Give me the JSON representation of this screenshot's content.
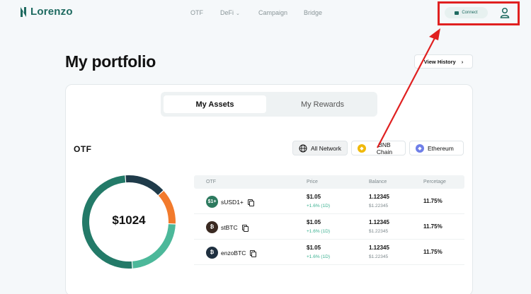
{
  "brand": {
    "name": "Lorenzo"
  },
  "nav": [
    {
      "label": "OTF"
    },
    {
      "label": "DeFi"
    },
    {
      "label": "Campaign"
    },
    {
      "label": "Bridge"
    }
  ],
  "header": {
    "connect_label": "Connect"
  },
  "page": {
    "title": "My portfolio",
    "view_history_label": "View History"
  },
  "tabs": [
    {
      "label": "My Assets",
      "active": true
    },
    {
      "label": "My Rewards",
      "active": false
    }
  ],
  "section": {
    "label": "OTF"
  },
  "networks": [
    {
      "label": "All Network",
      "icon": "globe-icon",
      "selected": true
    },
    {
      "label": "BNB Chain",
      "icon": "bnb-icon",
      "color": "#f0b90b"
    },
    {
      "label": "Ethereum",
      "icon": "ethereum-icon",
      "color": "#6f7fe8"
    }
  ],
  "total": {
    "value": "$1024"
  },
  "donut_segments": [
    {
      "color": "#1f3b4a",
      "fraction": 0.145
    },
    {
      "color": "#f27a2c",
      "fraction": 0.125
    },
    {
      "color": "#4cb89a",
      "fraction": 0.23
    },
    {
      "color": "#237a68",
      "fraction": 0.5
    }
  ],
  "table": {
    "headers": [
      "OTF",
      "Price",
      "Balance",
      "Percetage"
    ],
    "rows": [
      {
        "name": "sUSD1+",
        "coin_color": "#2d7a5f",
        "coin_text": "$1+",
        "price": "$1.05",
        "change": "+1.6% (1D)",
        "balance": "1.12345",
        "balance_usd": "$1.22345",
        "percent": "11.75%"
      },
      {
        "name": "stBTC",
        "coin_color": "#3a2a22",
        "coin_text": "₿",
        "price": "$1.05",
        "change": "+1.6% (1D)",
        "balance": "1.12345",
        "balance_usd": "$1.22345",
        "percent": "11.75%"
      },
      {
        "name": "enzoBTC",
        "coin_color": "#1f3040",
        "coin_text": "₿",
        "price": "$1.05",
        "change": "+1.6% (1D)",
        "balance": "1.12345",
        "balance_usd": "$1.22345",
        "percent": "11.75%"
      }
    ]
  },
  "colors": {
    "brand": "#1e6a60",
    "highlight": "#e02020",
    "positive": "#3ab090"
  }
}
